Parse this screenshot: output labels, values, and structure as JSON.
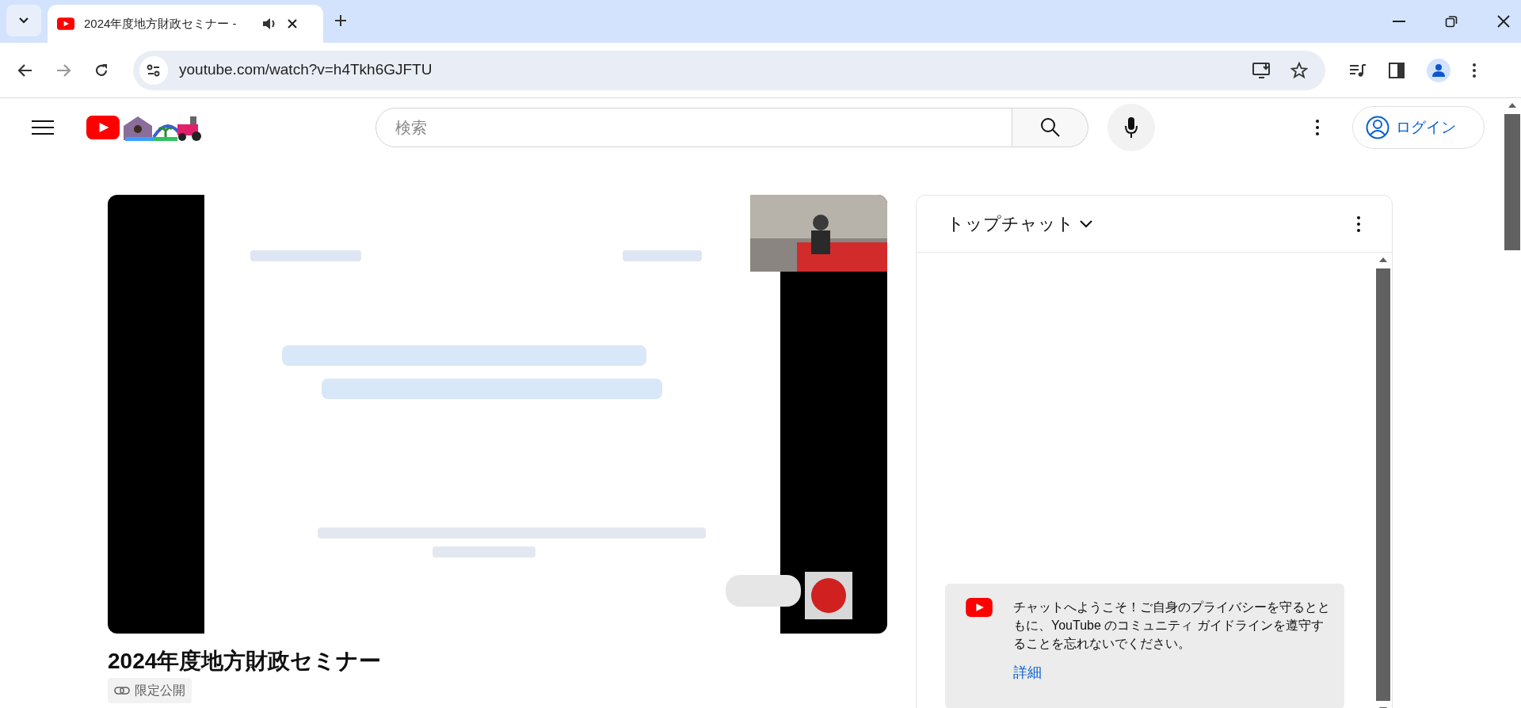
{
  "browser": {
    "tab": {
      "title": "2024年度地方財政セミナー -"
    },
    "address": "youtube.com/watch?v=h4Tkh6GJFTU"
  },
  "header": {
    "search": {
      "placeholder": "検索"
    },
    "login": "ログイン"
  },
  "video": {
    "title": "2024年度地方財政セミナー",
    "visibility": "限定公開"
  },
  "chat": {
    "header": "トップチャット",
    "welcome": "チャットへようこそ！ご自身のプライバシーを守るとともに、YouTube のコミュニティ ガイドラインを遵守することを忘れないでください。",
    "link": "詳細"
  }
}
